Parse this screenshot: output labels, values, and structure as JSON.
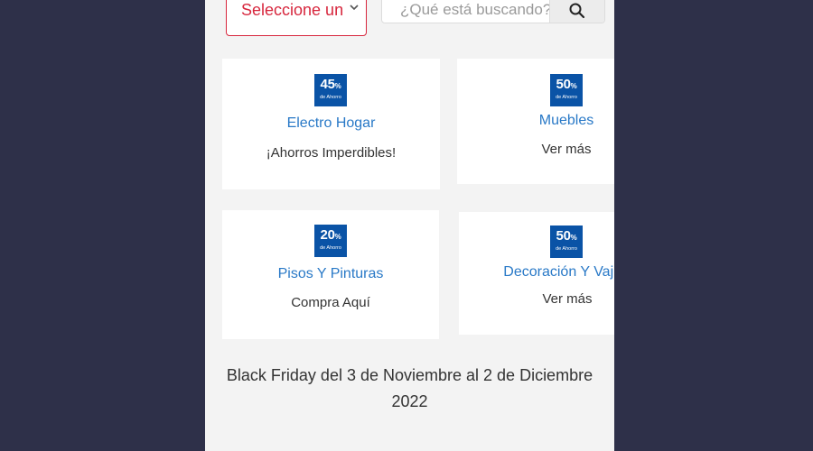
{
  "filters": {
    "select_label": "Seleccione un",
    "search_placeholder": "¿Qué está buscando?"
  },
  "cards": [
    {
      "badge_pct": "45",
      "badge_sub": "de Ahorro",
      "title": "Electro Hogar",
      "subtitle": "¡Ahorros Imperdibles!"
    },
    {
      "badge_pct": "50",
      "badge_sub": "de Ahorro",
      "title": "Muebles",
      "subtitle": "Ver más"
    },
    {
      "badge_pct": "20",
      "badge_sub": "de Ahorro",
      "title": "Pisos Y Pinturas",
      "subtitle": "Compra Aquí"
    },
    {
      "badge_pct": "50",
      "badge_sub": "de Ahorro",
      "title": "Decoración Y Vajilla",
      "subtitle": "Ver más"
    }
  ],
  "footer": {
    "line1": "Black Friday del 3 de Noviembre al 2 de Diciembre",
    "line2": "2022"
  },
  "colors": {
    "page_background": "#2e3049",
    "badge": "#0a53a6",
    "link": "#2979c7",
    "select_accent": "#d7263d"
  }
}
